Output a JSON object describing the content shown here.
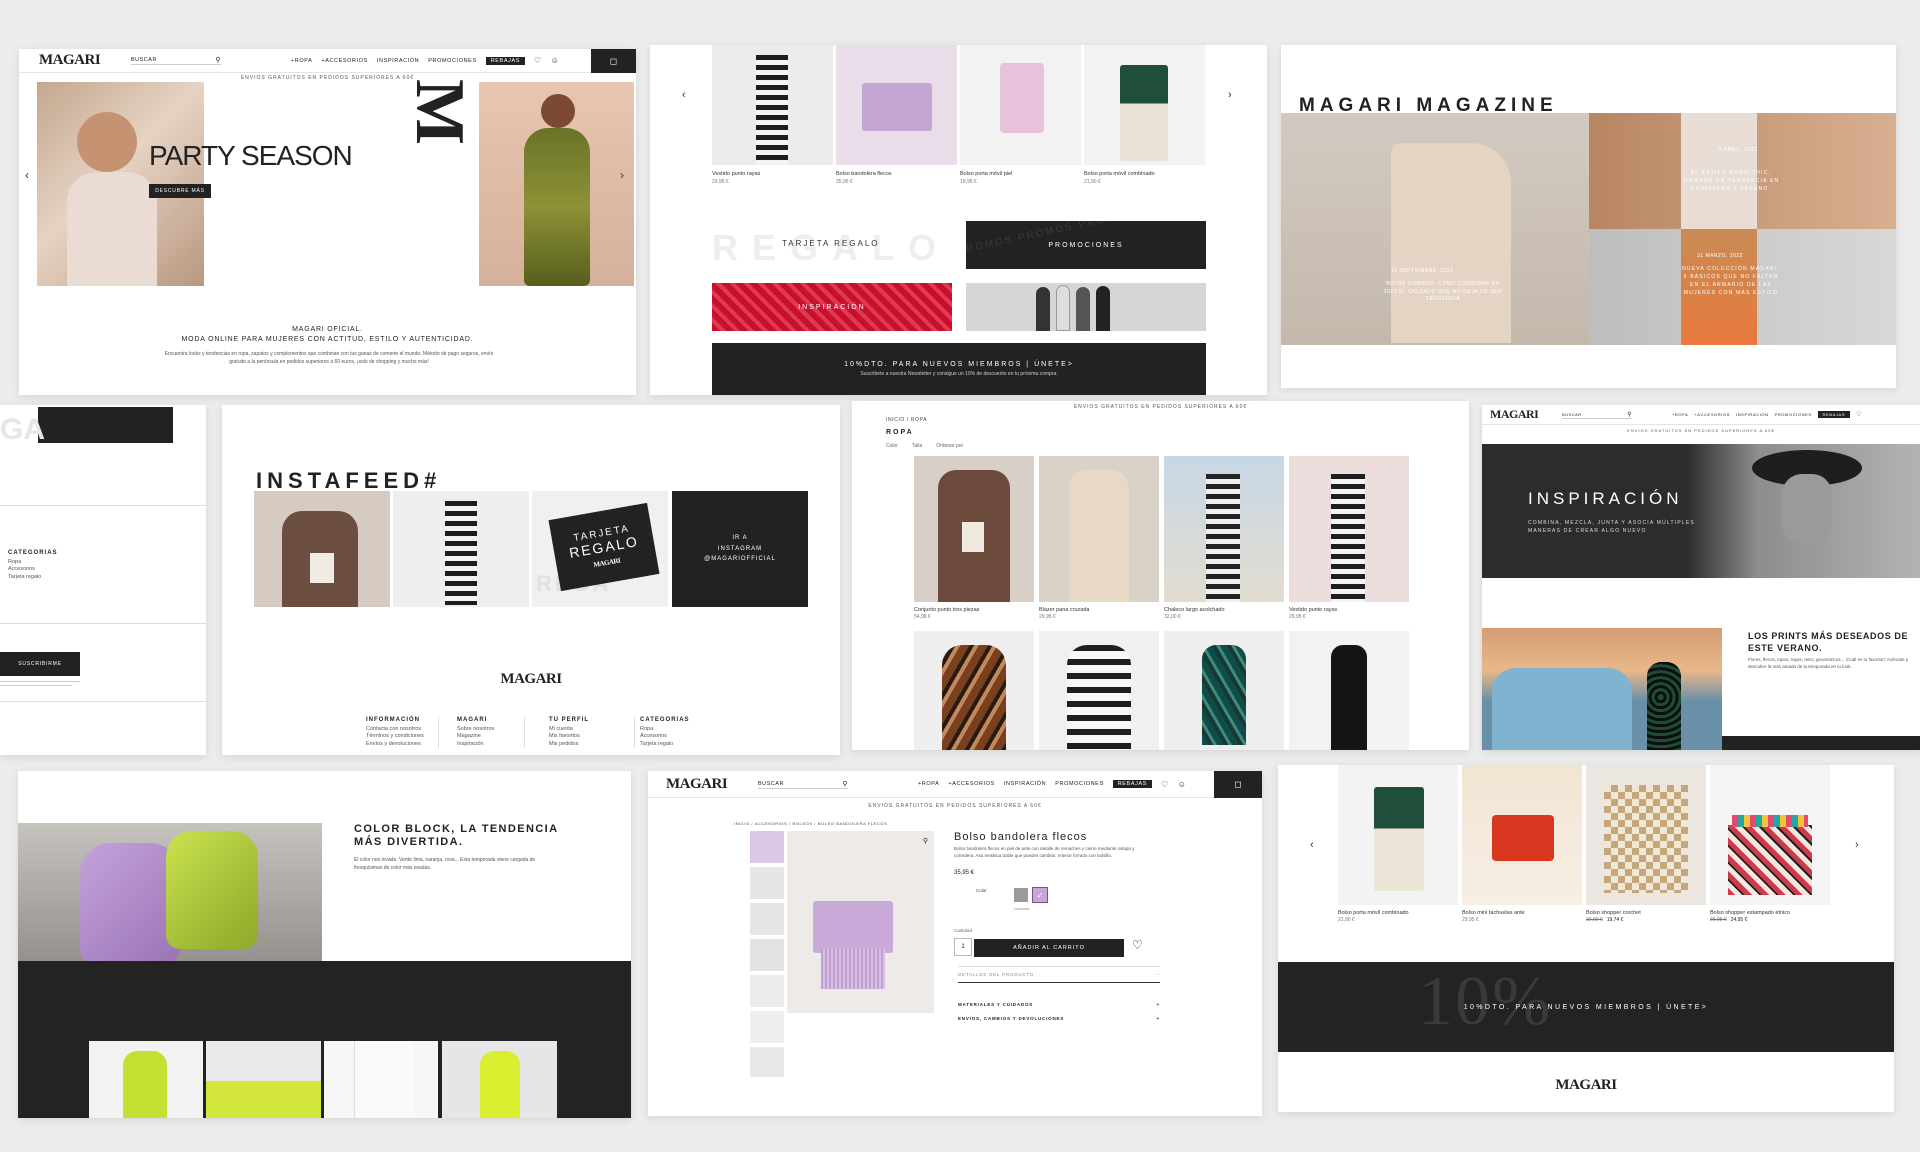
{
  "colors": {
    "dark": "#222222",
    "accent_lilac": "#c9a6d9",
    "accent_lime": "#b6d43a",
    "bg": "#ececec"
  },
  "header": {
    "logo": "MAGARI",
    "search_label": "BUSCAR",
    "nav": [
      "+ROPA",
      "+ACCESORIOS",
      "INSPIRACIÓN",
      "PROMOCIONES",
      "REBAJAS"
    ],
    "ship_bar": "ENVIOS GRATUITOS EN PEDIDOS SUPERIORES A 60€"
  },
  "hero": {
    "title": "PARTY SEASON",
    "cta": "DESCUBRE MÁS",
    "intro_title_1": "MAGARI OFICIAL.",
    "intro_title_2": "MODA ONLINE PARA MUJERES CON ACTITUD, ESTILO Y AUTENTICIDAD.",
    "intro_text": "Encuentra looks y tendencias en ropa, zapatos y complementos que combinan con tus ganas de comerte el mundo. Método de pago seguros, envío gratuito a la península en pedidos superiores a 60 euros, ¡solo de shopping y mucho más!"
  },
  "carousel_top": [
    {
      "name": "Vestido punto rayas",
      "price": "29,95 €"
    },
    {
      "name": "Bolso bandolera flecos",
      "price": "35,95 €"
    },
    {
      "name": "Bolso porta móvil piel",
      "price": "19,95 €"
    },
    {
      "name": "Bolso porta móvil combinado",
      "price": "21,90 €"
    }
  ],
  "promo_blocks": {
    "gift": "TARJETA REGALO",
    "gift_bg": "REGALO",
    "promos": "PROMOCIONES",
    "promos_bg": "PROMOS·PROMOS·PROMOS",
    "inspo": "INSPIRACIÓN",
    "newsletter": "10%DTO. PARA NUEVOS MIEMBROS | ÚNETE>",
    "newsletter_sub": "Suscríbete a nuestra Newsletter y consigue un 10% de descuento en tu próxima compra."
  },
  "magazine": {
    "title": "MAGARI MAGAZINE",
    "a1_date": "15 SEPTIEMBRE, 2022",
    "a1_text": "BOTAS COWBOY: CÓMO COMBINAR EN 2022 EL CALZADO QUE NO DEJA DE SER TENDENCIA",
    "a2_date": "6 ABRIL, 2022",
    "a2_text": "EL ESTILO BOHO CHIC, SIEMPRE EN TENDENCIA EN PRIMAVERA Y VERANO.",
    "a3_date": "31 MARZO, 2022",
    "a3_text": "NUEVA COLECCIÓN MAGARI: 5 BÁSICOS QUE NO FALTAN EN EL ARMARIO DE LAS MUJERES CON MÁS ESTILO"
  },
  "left_footer": {
    "cat_title": "CATEGORIAS",
    "cats": [
      "Ropa",
      "Accesorios",
      "Tarjeta regalo"
    ],
    "subscribe": "SUSCRIBIRME"
  },
  "instafeed": {
    "title": "INSTAFEED#",
    "gift_card_l1": "TARJETA",
    "gift_card_l2": "REGALO",
    "gift_card_logo": "MAGARI",
    "ig_l1": "IR A",
    "ig_l2": "INSTAGRAM",
    "ig_l3": "@MAGARIOFFICIAL",
    "footer_logo": "MAGARI",
    "footer_cols": [
      {
        "title": "INFORMACIÓN",
        "items": [
          "Contacta con nosotros",
          "Términos y condiciones",
          "Envíos y devoluciones"
        ]
      },
      {
        "title": "MAGARI",
        "items": [
          "Sobre nosotros",
          "Magazine",
          "Inspiración"
        ]
      },
      {
        "title": "TU PERFIL",
        "items": [
          "Mi cuenta",
          "Mis favoritos",
          "Mis pedidos"
        ]
      },
      {
        "title": "CATEGORIAS",
        "items": [
          "Ropa",
          "Accesorios",
          "Tarjeta regalo"
        ]
      }
    ]
  },
  "listing": {
    "ship_bar": "ENVIOS GRATUITOS EN PEDIDOS SUPERIORES A 60€",
    "breadcrumb": "INICIO / ROPA",
    "title": "ROPA",
    "filters": [
      "Color",
      "Talla",
      "Ordenar por"
    ],
    "products": [
      {
        "name": "Conjunto punto tres piezas",
        "price": "54,98 €"
      },
      {
        "name": "Blazer pana cruzada",
        "price": "29,95 €"
      },
      {
        "name": "Chaleco largo acolchado",
        "price": "32,00 €"
      },
      {
        "name": "Vestido punto rayas",
        "price": "29,95 €"
      }
    ]
  },
  "inspo_page": {
    "title": "INSPIRACIÓN",
    "subtitle": "COMBINA, MEZCLA, JUNTA Y ASOCIA MÚLTIPLES MANERAS DE CREAR ALGO NUEVO",
    "article_title": "LOS PRINTS MÁS DESEADOS DE ESTE VERANO.",
    "article_text": "Flores, flecos, topos, rayas, retro, geométricos... ¡Cuál es tu favorito? Acércate y descubre la más amada de la temporada en tu look."
  },
  "color_block": {
    "title": "COLOR BLOCK, LA TENDENCIA MÁS DIVERTIDA.",
    "text": "El color nos invade. Verde lima, naranja, rosa... Esta temporada viene cargada de fresquísimas de color más osadas."
  },
  "pdp": {
    "breadcrumb": "INICIO / ACCESORIOS / BOLSOS / BOLSO BANDOLERA FLECOS",
    "title": "Bolso bandolera flecos",
    "desc": "Bolso bandolera flecos en piel de ante con detalle de remaches y cierre mediante solapa y corredera. Asa metálica doble que puedes cambiar. Interior forrado con bolsillo.",
    "price": "35,95 €",
    "color_label": "Color",
    "swatch_label": "Lavanda",
    "qty_label": "Cantidad",
    "qty_value": "1",
    "add_btn": "AÑADIR AL CARRITO",
    "details": "DETALLES DEL PRODUCTO",
    "materials": "MATERIALES Y CUIDADOS",
    "shipping": "ENVÍOS, CAMBIOS Y DEVOLUCIONES"
  },
  "bags_carousel": [
    {
      "name": "Bolso porta móvil combinado",
      "price": "21,90 €",
      "old": ""
    },
    {
      "name": "Bolso mini tachuelas ante",
      "price": "29,95 €",
      "old": ""
    },
    {
      "name": "Bolso shopper crochet",
      "price": "19,74 €",
      "old": "32,90 €"
    },
    {
      "name": "Bolso shopper estampado étnico",
      "price": "24,95 €",
      "old": "35,95 €"
    }
  ],
  "newsletter_bottom": {
    "big": "10%",
    "text": "10%DTO. PARA NUEVOS MIEMBROS | ÚNETE>",
    "logo": "MAGARI"
  }
}
